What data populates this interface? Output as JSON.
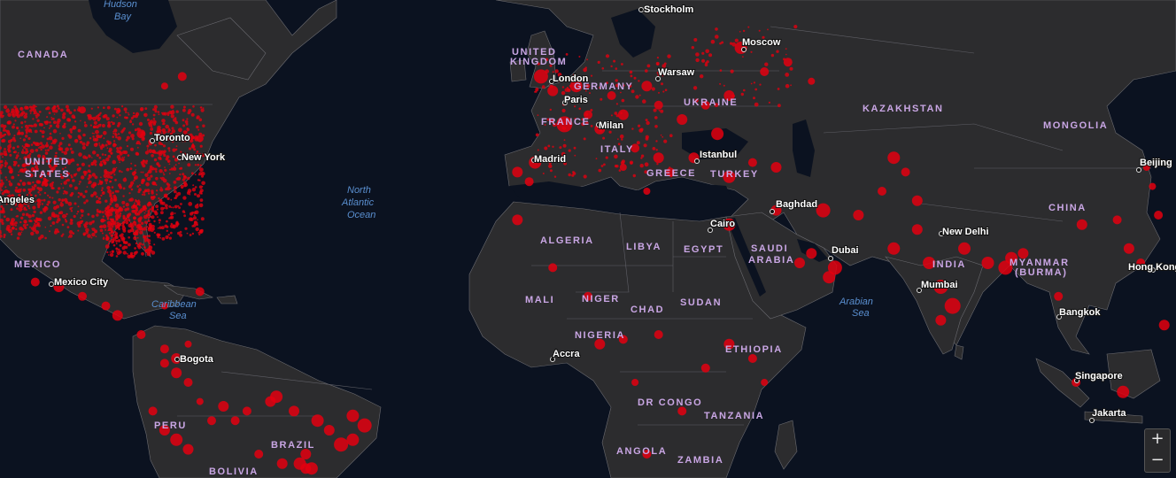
{
  "map": {
    "colors": {
      "ocean": "#0b1220",
      "land": "#2c2c2e",
      "border": "#6b6b70",
      "marker": "#e3000f",
      "country_label": "#c9a6e4",
      "water_label": "#5a8fd0"
    },
    "countries": [
      "CANADA",
      "UNITED STATES",
      "MEXICO",
      "BRAZIL",
      "PERU",
      "BOLIVIA",
      "UNITED KINGDOM",
      "FRANCE",
      "GERMANY",
      "UKRAINE",
      "ITALY",
      "GREECE",
      "TURKEY",
      "KAZAKHSTAN",
      "MONGOLIA",
      "CHINA",
      "INDIA",
      "MYANMAR (BURMA)",
      "SAUDI ARABIA",
      "EGYPT",
      "LIBYA",
      "ALGERIA",
      "MALI",
      "NIGER",
      "CHAD",
      "SUDAN",
      "NIGERIA",
      "ETHIOPIA",
      "DR CONGO",
      "TANZANIA",
      "ANGOLA",
      "ZAMBIA"
    ],
    "cities": [
      "Toronto",
      "New York",
      "Mexico City",
      "Bogota",
      "London",
      "Paris",
      "Madrid",
      "Milan",
      "Stockholm",
      "Warsaw",
      "Moscow",
      "Istanbul",
      "Cairo",
      "Baghdad",
      "Dubai",
      "New Delhi",
      "Mumbai",
      "Bangkok",
      "Beijing",
      "Hong Kong",
      "Singapore",
      "Jakarta",
      "Accra",
      "Los Angeles"
    ],
    "water": [
      "Hudson Bay",
      "North Atlantic Ocean",
      "Caribbean Sea",
      "Arabian Sea"
    ],
    "zoom": {
      "in": "+",
      "out": "−"
    },
    "markers": [
      [
        0.07,
        0.23,
        4
      ],
      [
        0.12,
        0.28,
        5
      ],
      [
        0.14,
        0.18,
        4
      ],
      [
        0.155,
        0.16,
        5
      ],
      [
        0.17,
        0.29,
        4
      ],
      [
        0.46,
        0.16,
        8
      ],
      [
        0.47,
        0.19,
        6
      ],
      [
        0.49,
        0.18,
        7
      ],
      [
        0.48,
        0.26,
        9
      ],
      [
        0.455,
        0.34,
        7
      ],
      [
        0.44,
        0.36,
        6
      ],
      [
        0.45,
        0.38,
        5
      ],
      [
        0.51,
        0.27,
        6
      ],
      [
        0.5,
        0.24,
        5
      ],
      [
        0.53,
        0.24,
        6
      ],
      [
        0.52,
        0.2,
        5
      ],
      [
        0.55,
        0.18,
        6
      ],
      [
        0.56,
        0.22,
        5
      ],
      [
        0.58,
        0.25,
        6
      ],
      [
        0.6,
        0.22,
        5
      ],
      [
        0.62,
        0.2,
        6
      ],
      [
        0.63,
        0.1,
        7
      ],
      [
        0.65,
        0.15,
        5
      ],
      [
        0.67,
        0.13,
        5
      ],
      [
        0.69,
        0.17,
        4
      ],
      [
        0.54,
        0.31,
        5
      ],
      [
        0.56,
        0.33,
        6
      ],
      [
        0.53,
        0.35,
        4
      ],
      [
        0.55,
        0.4,
        4
      ],
      [
        0.57,
        0.36,
        5
      ],
      [
        0.59,
        0.33,
        6
      ],
      [
        0.61,
        0.28,
        7
      ],
      [
        0.62,
        0.37,
        7
      ],
      [
        0.64,
        0.34,
        5
      ],
      [
        0.66,
        0.35,
        6
      ],
      [
        0.7,
        0.44,
        8
      ],
      [
        0.66,
        0.44,
        6
      ],
      [
        0.62,
        0.47,
        7
      ],
      [
        0.68,
        0.55,
        6
      ],
      [
        0.71,
        0.56,
        8
      ],
      [
        0.69,
        0.53,
        6
      ],
      [
        0.705,
        0.58,
        7
      ],
      [
        0.73,
        0.45,
        6
      ],
      [
        0.76,
        0.33,
        7
      ],
      [
        0.77,
        0.36,
        5
      ],
      [
        0.78,
        0.42,
        6
      ],
      [
        0.75,
        0.4,
        5
      ],
      [
        0.76,
        0.52,
        7
      ],
      [
        0.78,
        0.48,
        6
      ],
      [
        0.79,
        0.55,
        7
      ],
      [
        0.8,
        0.6,
        8
      ],
      [
        0.81,
        0.64,
        9
      ],
      [
        0.8,
        0.67,
        6
      ],
      [
        0.82,
        0.52,
        7
      ],
      [
        0.84,
        0.55,
        7
      ],
      [
        0.855,
        0.56,
        8
      ],
      [
        0.86,
        0.54,
        7
      ],
      [
        0.87,
        0.53,
        6
      ],
      [
        0.9,
        0.62,
        5
      ],
      [
        0.92,
        0.47,
        6
      ],
      [
        0.95,
        0.46,
        5
      ],
      [
        0.96,
        0.52,
        6
      ],
      [
        0.97,
        0.55,
        5
      ],
      [
        0.955,
        0.82,
        7
      ],
      [
        0.915,
        0.8,
        5
      ],
      [
        0.99,
        0.68,
        6
      ],
      [
        0.985,
        0.45,
        5
      ],
      [
        0.975,
        0.35,
        4
      ],
      [
        0.98,
        0.39,
        4
      ],
      [
        0.44,
        0.46,
        6
      ],
      [
        0.47,
        0.56,
        5
      ],
      [
        0.5,
        0.62,
        5
      ],
      [
        0.51,
        0.72,
        6
      ],
      [
        0.53,
        0.71,
        5
      ],
      [
        0.56,
        0.7,
        5
      ],
      [
        0.62,
        0.72,
        6
      ],
      [
        0.6,
        0.77,
        5
      ],
      [
        0.64,
        0.75,
        5
      ],
      [
        0.65,
        0.8,
        4
      ],
      [
        0.54,
        0.8,
        4
      ],
      [
        0.58,
        0.86,
        5
      ],
      [
        0.55,
        0.95,
        5
      ],
      [
        0.03,
        0.59,
        5
      ],
      [
        0.05,
        0.6,
        6
      ],
      [
        0.07,
        0.62,
        5
      ],
      [
        0.09,
        0.64,
        5
      ],
      [
        0.1,
        0.66,
        6
      ],
      [
        0.12,
        0.7,
        5
      ],
      [
        0.14,
        0.73,
        5
      ],
      [
        0.15,
        0.75,
        6
      ],
      [
        0.16,
        0.72,
        4
      ],
      [
        0.17,
        0.61,
        5
      ],
      [
        0.14,
        0.64,
        4
      ],
      [
        0.14,
        0.76,
        5
      ],
      [
        0.15,
        0.78,
        6
      ],
      [
        0.16,
        0.8,
        5
      ],
      [
        0.17,
        0.84,
        4
      ],
      [
        0.13,
        0.86,
        5
      ],
      [
        0.14,
        0.9,
        6
      ],
      [
        0.15,
        0.92,
        7
      ],
      [
        0.16,
        0.94,
        6
      ],
      [
        0.18,
        0.88,
        5
      ],
      [
        0.19,
        0.85,
        6
      ],
      [
        0.2,
        0.88,
        5
      ],
      [
        0.21,
        0.86,
        5
      ],
      [
        0.23,
        0.84,
        6
      ],
      [
        0.235,
        0.83,
        7
      ],
      [
        0.25,
        0.86,
        6
      ],
      [
        0.27,
        0.88,
        7
      ],
      [
        0.28,
        0.9,
        6
      ],
      [
        0.29,
        0.93,
        8
      ],
      [
        0.3,
        0.87,
        7
      ],
      [
        0.31,
        0.89,
        8
      ],
      [
        0.3,
        0.92,
        7
      ],
      [
        0.26,
        0.95,
        6
      ],
      [
        0.24,
        0.97,
        6
      ],
      [
        0.22,
        0.95,
        5
      ],
      [
        0.26,
        0.98,
        6
      ],
      [
        0.265,
        0.98,
        7
      ],
      [
        0.255,
        0.97,
        7
      ]
    ]
  }
}
